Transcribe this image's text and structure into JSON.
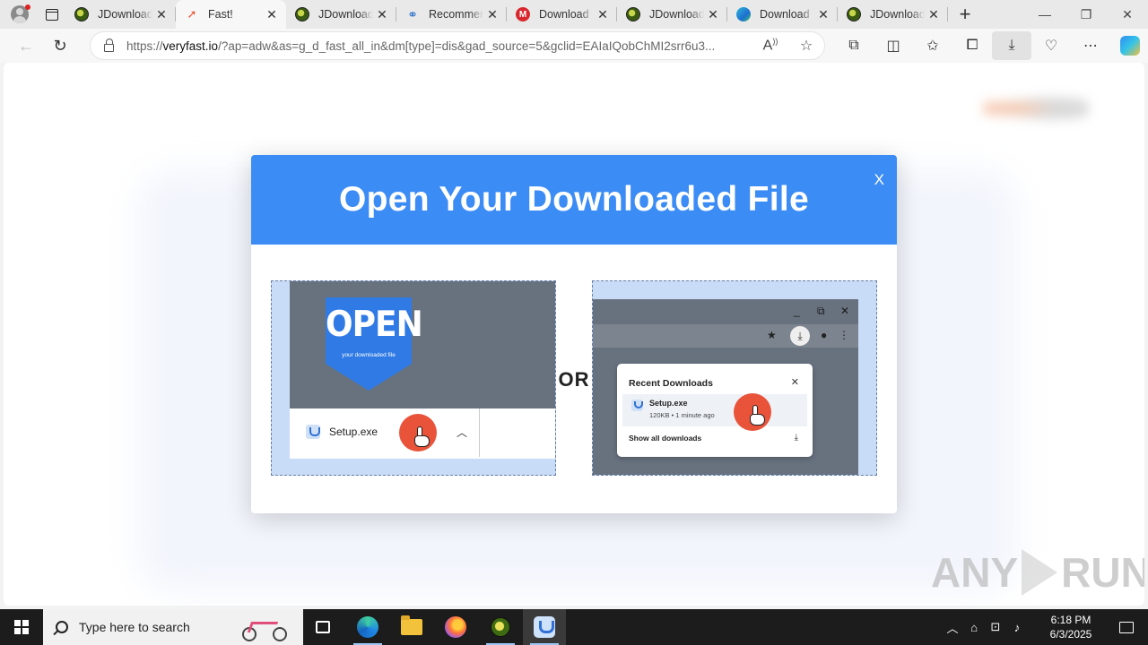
{
  "browser": {
    "tabs": [
      {
        "title": "JDownloader",
        "favicon": "jdownloader-icon",
        "active": false
      },
      {
        "title": "Fast!",
        "favicon": "rocket-icon",
        "active": true
      },
      {
        "title": "JDownloader",
        "favicon": "jdownloader-icon",
        "active": false
      },
      {
        "title": "Recommended",
        "favicon": "link-icon",
        "active": false
      },
      {
        "title": "Download",
        "favicon": "mega-icon",
        "active": false
      },
      {
        "title": "JDownloader",
        "favicon": "jdownloader-icon",
        "active": false
      },
      {
        "title": "Download",
        "favicon": "edge-icon",
        "active": false
      },
      {
        "title": "JDownloader",
        "favicon": "jdownloader-icon",
        "active": false
      }
    ],
    "url": {
      "scheme": "https://",
      "host": "veryfast.io",
      "rest": "/?ap=adw&as=g_d_fast_all_in&dm[type]=dis&gad_source=5&gclid=EAIaIQobChMI2srr6u3..."
    }
  },
  "modal": {
    "title": "Open Your Downloaded File",
    "close_label": "X",
    "or_label": "OR",
    "left_panel": {
      "badge_text": "OPEN",
      "badge_subtext": "your downloaded file",
      "file_name": "Setup.exe"
    },
    "right_panel": {
      "popup_title": "Recent Downloads",
      "file_name": "Setup.exe",
      "file_meta": "120KB • 1 minute ago",
      "show_all": "Show all downloads"
    }
  },
  "watermark": {
    "left": "ANY",
    "right": "RUN"
  },
  "taskbar": {
    "search_placeholder": "Type here to search",
    "time": "6:18 PM",
    "date": "6/3/2025"
  }
}
